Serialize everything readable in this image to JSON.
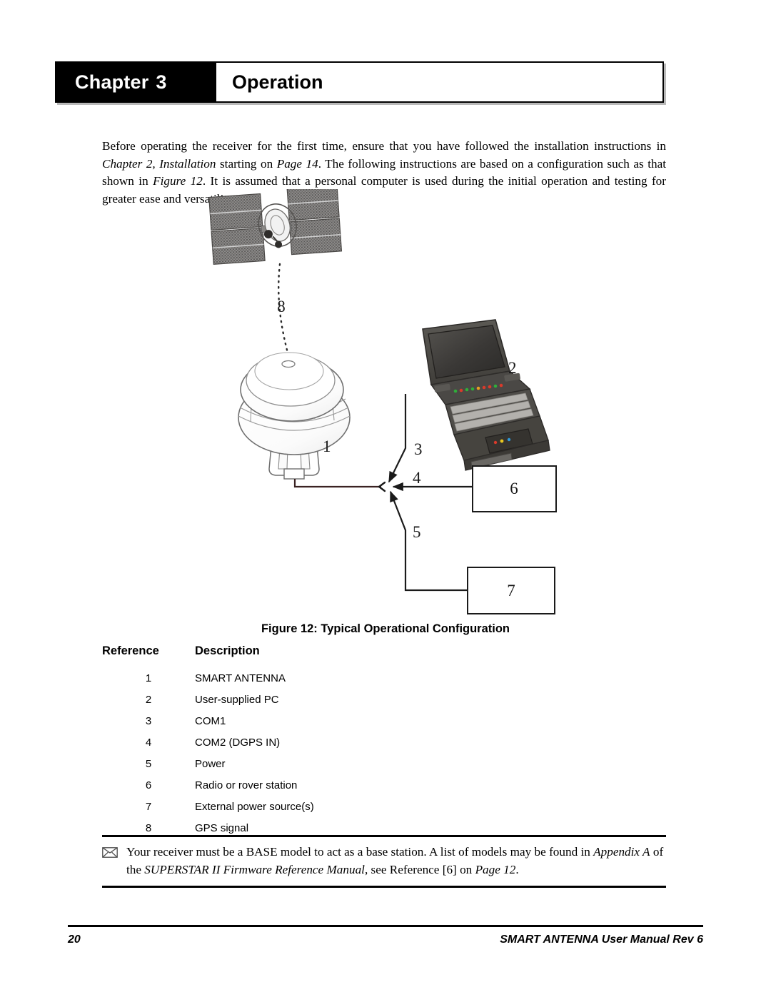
{
  "header": {
    "chapter_word": "Chapter",
    "chapter_number": "3",
    "title": "Operation"
  },
  "intro": {
    "part1": "Before operating the receiver for the first time, ensure that you have followed the installation instructions in ",
    "em1": "Chapter 2, Installation",
    "part2": " starting on ",
    "em2": "Page 14",
    "part3": ". The following instructions are based on a configuration such as that shown in ",
    "em3": "Figure 12",
    "part4": ". It is assumed that a personal computer is used during the initial operation and testing for greater ease and versatility."
  },
  "figure": {
    "caption": "Figure 12: Typical Operational Configuration",
    "callouts": {
      "antenna": "1",
      "pc": "2",
      "com1": "3",
      "com2": "4",
      "power": "5",
      "radio_box": "6",
      "power_box": "7",
      "gps_signal": "8"
    },
    "icon_names": {
      "satellite": "satellite-icon",
      "antenna": "smart-antenna-icon",
      "laptop": "laptop-icon"
    }
  },
  "table": {
    "headers": [
      "Reference",
      "Description"
    ],
    "rows": [
      {
        "ref": "1",
        "desc": "SMART ANTENNA"
      },
      {
        "ref": "2",
        "desc": "User-supplied PC"
      },
      {
        "ref": "3",
        "desc": "COM1"
      },
      {
        "ref": "4",
        "desc": "COM2 (DGPS IN)"
      },
      {
        "ref": "5",
        "desc": "Power"
      },
      {
        "ref": "6",
        "desc": "Radio or rover station"
      },
      {
        "ref": "7",
        "desc": "External power source(s)"
      },
      {
        "ref": "8",
        "desc": "GPS signal"
      }
    ]
  },
  "note": {
    "icon": "envelope-icon",
    "part1": "Your receiver must be a BASE model to act as a base station. A list of models may be found in ",
    "em1": "Appendix A",
    "part2": " of the ",
    "em2": "SUPERSTAR II Firmware Reference Manual",
    "part3": ", see Reference [6] on ",
    "em3": "Page 12",
    "part4": "."
  },
  "footer": {
    "page_number": "20",
    "manual_title": "SMART ANTENNA User Manual Rev 6"
  },
  "colors": {
    "badge_bg": "#000000",
    "badge_text": "#ffffff",
    "body_text": "#000000",
    "rule": "#000000"
  }
}
